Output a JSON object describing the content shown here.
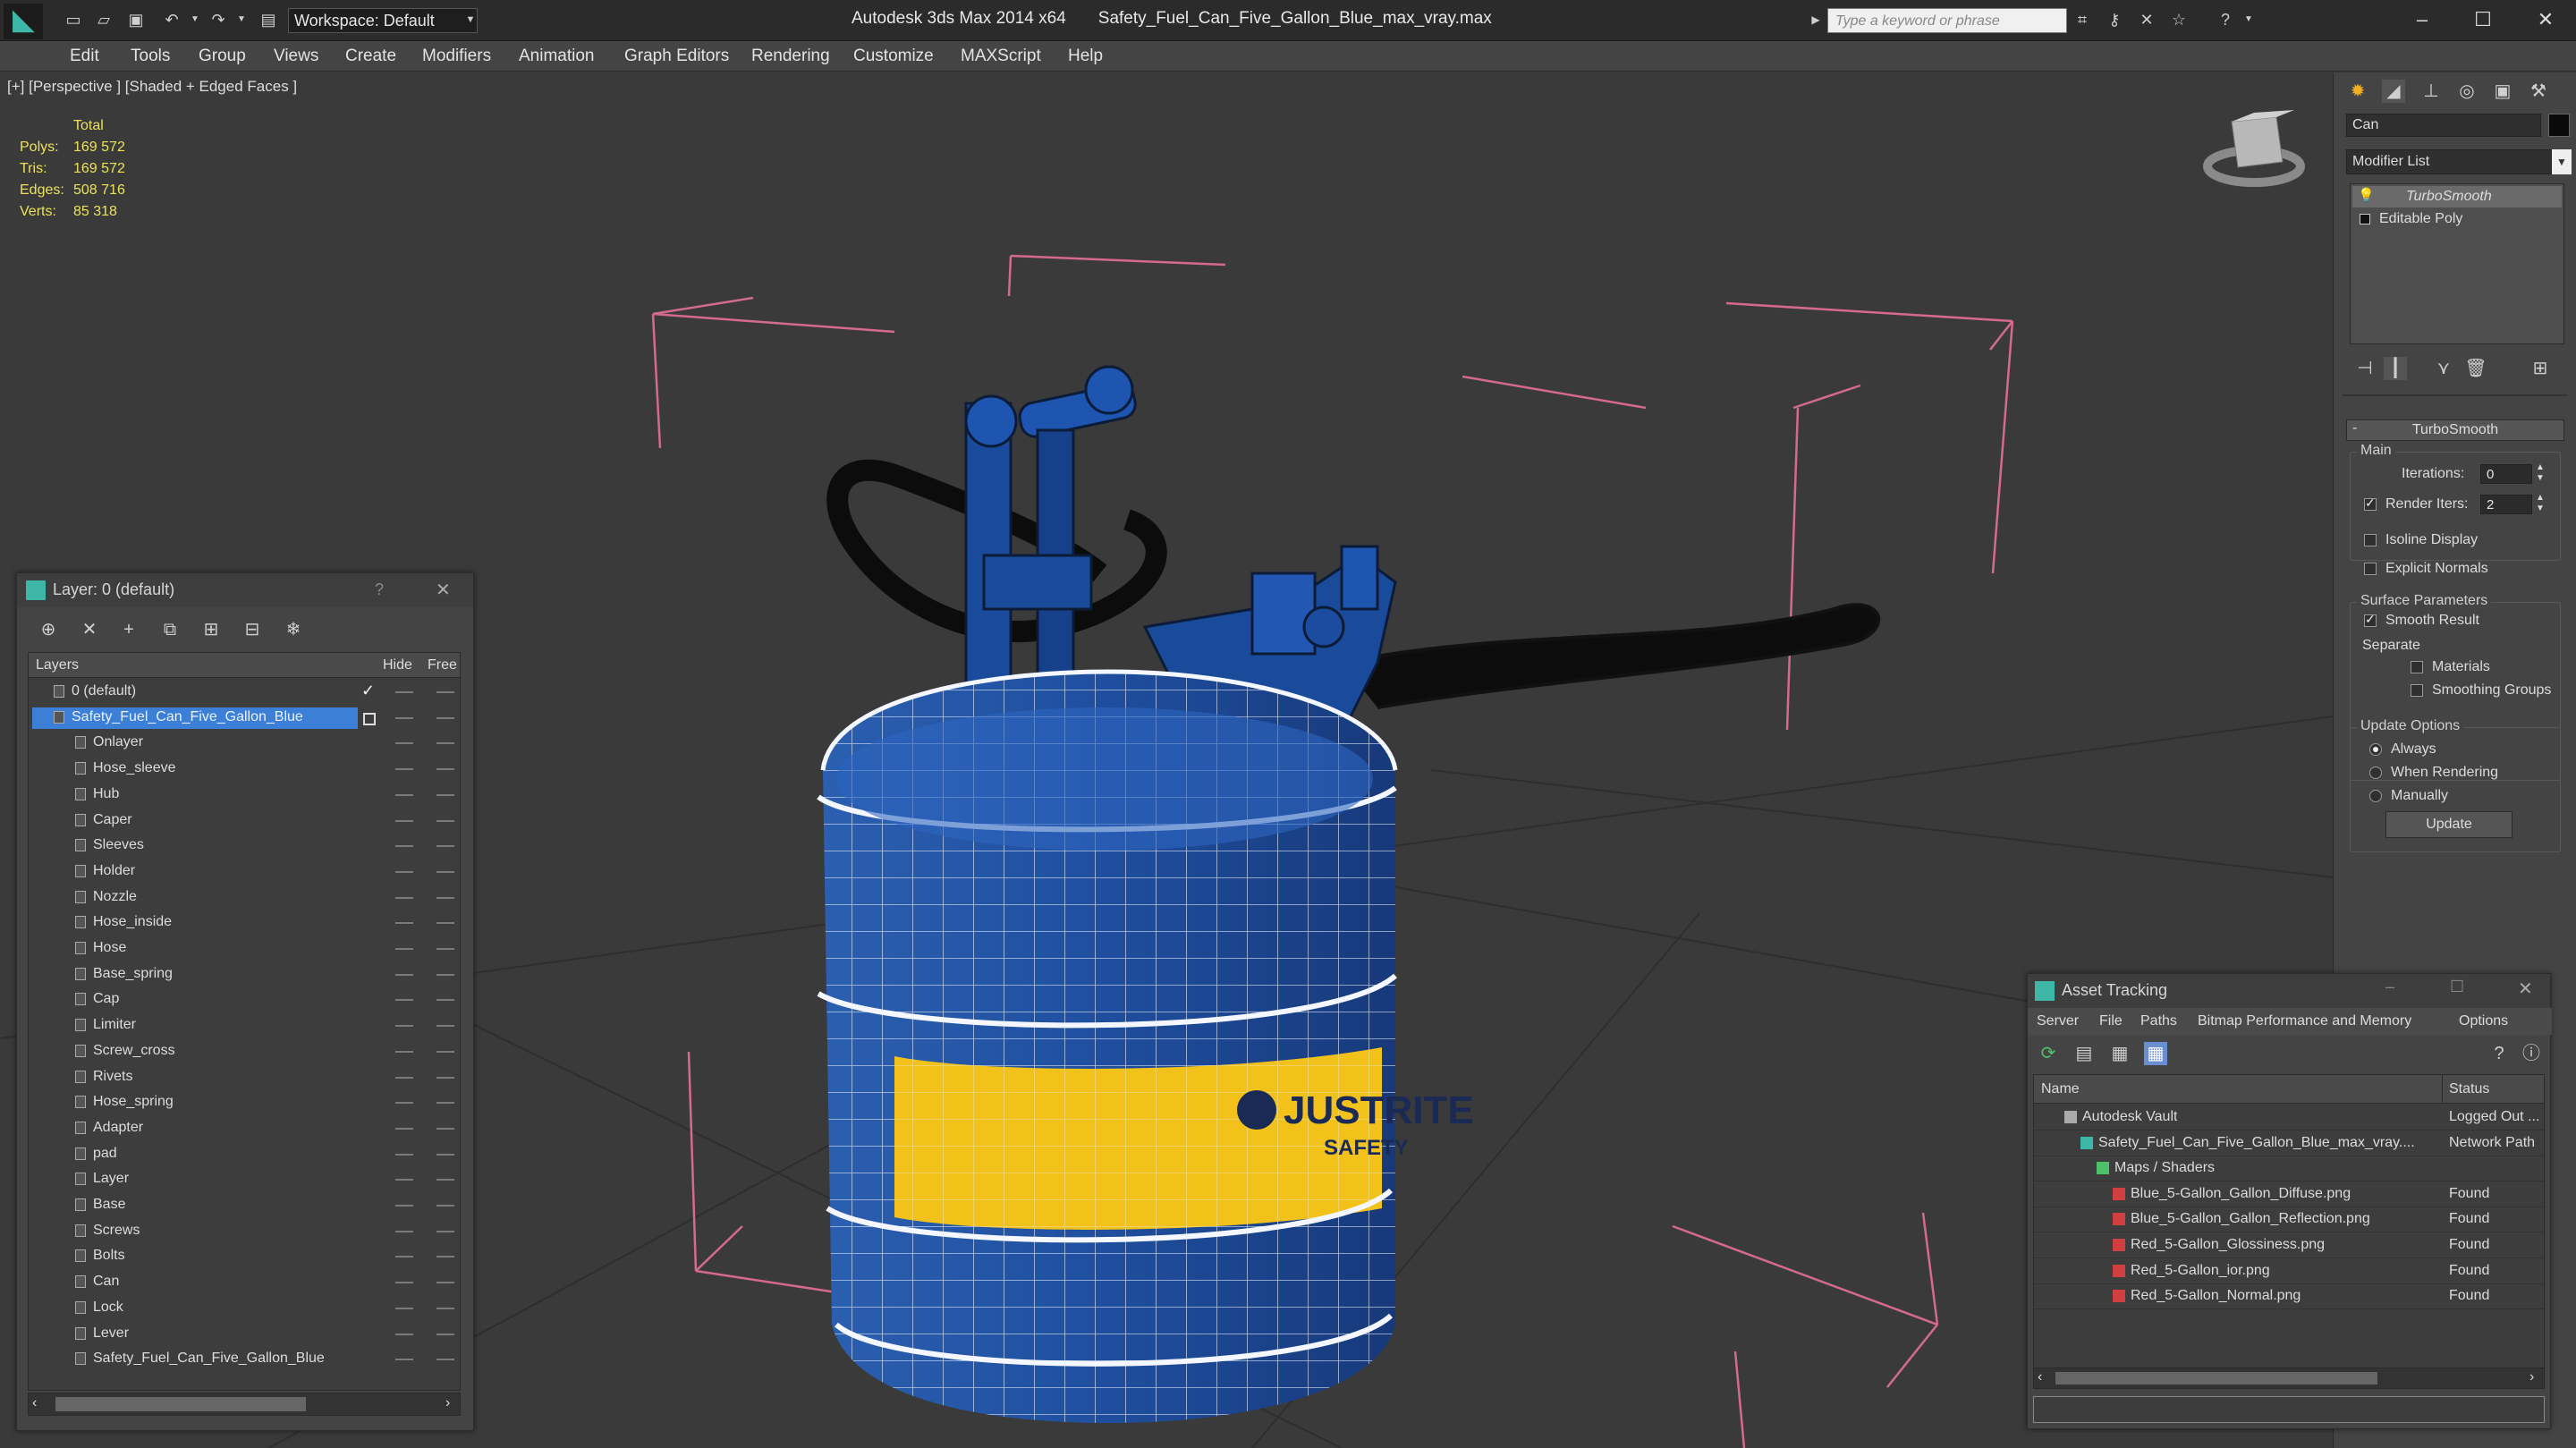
{
  "titlebar": {
    "app": "Autodesk 3ds Max  2014 x64",
    "file": "Safety_Fuel_Can_Five_Gallon_Blue_max_vray.max",
    "workspace": "Workspace: Default",
    "search_placeholder": "Type a keyword or phrase"
  },
  "menu": [
    "Edit",
    "Tools",
    "Group",
    "Views",
    "Create",
    "Modifiers",
    "Animation",
    "Graph Editors",
    "Rendering",
    "Customize",
    "MAXScript",
    "Help"
  ],
  "viewport": {
    "label": "[+] [Perspective ] [Shaded + Edged Faces ]",
    "stats": {
      "header": "Total",
      "rows": [
        {
          "label": "Polys:",
          "value": "169 572"
        },
        {
          "label": "Tris:",
          "value": "169 572"
        },
        {
          "label": "Edges:",
          "value": "508 716"
        },
        {
          "label": "Verts:",
          "value": "85 318"
        }
      ]
    }
  },
  "layer_panel": {
    "title": "Layer: 0 (default)",
    "col_layers": "Layers",
    "col_hide": "Hide",
    "col_freeze": "Free",
    "layers": [
      {
        "name": "0 (default)",
        "level": 0
      },
      {
        "name": "Safety_Fuel_Can_Five_Gallon_Blue",
        "level": 0,
        "selected": true
      }
    ],
    "objects": [
      "Onlayer",
      "Hose_sleeve",
      "Hub",
      "Caper",
      "Sleeves",
      "Holder",
      "Nozzle",
      "Hose_inside",
      "Hose",
      "Base_spring",
      "Cap",
      "Limiter",
      "Screw_cross",
      "Rivets",
      "Hose_spring",
      "Adapter",
      "pad",
      "Layer",
      "Base",
      "Screws",
      "Bolts",
      "Can",
      "Lock",
      "Lever",
      "Safety_Fuel_Can_Five_Gallon_Blue"
    ]
  },
  "command_panel": {
    "object_name": "Can",
    "modifier_list": "Modifier List",
    "stack": [
      "TurboSmooth",
      "Editable Poly"
    ],
    "rollout_title": "TurboSmooth",
    "main_label": "Main",
    "iterations_label": "Iterations:",
    "iterations_value": "0",
    "render_iters_label": "Render Iters:",
    "render_iters_value": "2",
    "isoline": "Isoline Display",
    "explicit_normals": "Explicit Normals",
    "surface_params": "Surface Parameters",
    "smooth_result": "Smooth Result",
    "separate": "Separate",
    "materials": "Materials",
    "smoothing_groups": "Smoothing Groups",
    "update_options": "Update Options",
    "always": "Always",
    "when_rendering": "When Rendering",
    "manually": "Manually",
    "update_button": "Update"
  },
  "asset_tracking": {
    "title": "Asset Tracking",
    "menu": [
      "Server",
      "File",
      "Paths",
      "Bitmap Performance and Memory",
      "Options"
    ],
    "col_name": "Name",
    "col_status": "Status",
    "rows": [
      {
        "name": "Autodesk Vault",
        "status": "Logged Out ...",
        "indent": 1
      },
      {
        "name": "Safety_Fuel_Can_Five_Gallon_Blue_max_vray....",
        "status": "Network Path",
        "indent": 2
      },
      {
        "name": "Maps / Shaders",
        "status": "",
        "indent": 3
      },
      {
        "name": "Blue_5-Gallon_Gallon_Diffuse.png",
        "status": "Found",
        "indent": 4
      },
      {
        "name": "Blue_5-Gallon_Gallon_Reflection.png",
        "status": "Found",
        "indent": 4
      },
      {
        "name": "Red_5-Gallon_Glossiness.png",
        "status": "Found",
        "indent": 4
      },
      {
        "name": "Red_5-Gallon_ior.png",
        "status": "Found",
        "indent": 4
      },
      {
        "name": "Red_5-Gallon_Normal.png",
        "status": "Found",
        "indent": 4
      }
    ]
  },
  "label_text": "JUSTRITE",
  "label_sub": "SAFETY"
}
